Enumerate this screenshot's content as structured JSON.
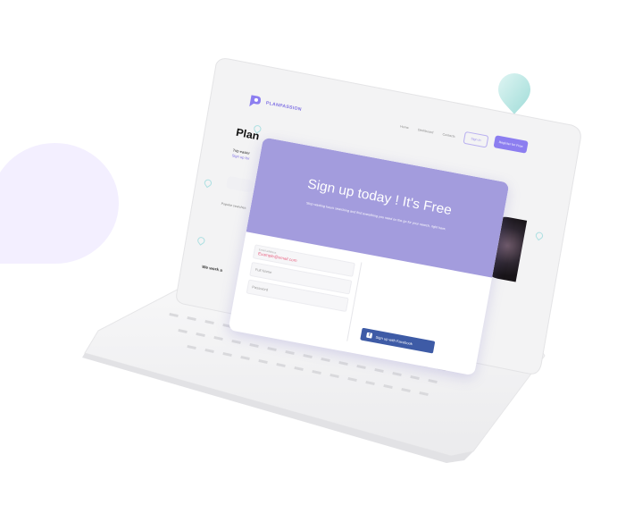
{
  "site": {
    "brand": "PLANPASSION",
    "nav_items": [
      "Home",
      "Dashboard",
      "Contacts"
    ],
    "sign_in": "Sign In",
    "register": "Register for Free",
    "hero_title": "Plan",
    "hero_sub1": "Trip easier",
    "hero_sub2": "Sign up for",
    "popular": "Popular searches",
    "we_are": "We work a"
  },
  "modal": {
    "title": "Sign up today ! It's Free",
    "description": "Stop wasting hours searching and find everything you need on the go for your search, right here.",
    "email_label": "Email address",
    "email_value": "Example@email.com",
    "fullname_placeholder": "Full Name",
    "password_placeholder": "Password",
    "facebook_button": "Sign up with Facebook",
    "facebook_icon": "f"
  },
  "colors": {
    "accent": "#8c7ef0",
    "modal_header": "#a39cdd",
    "facebook": "#3e5ba6",
    "pin": "#aee0e2",
    "blob": "#f3efff"
  }
}
